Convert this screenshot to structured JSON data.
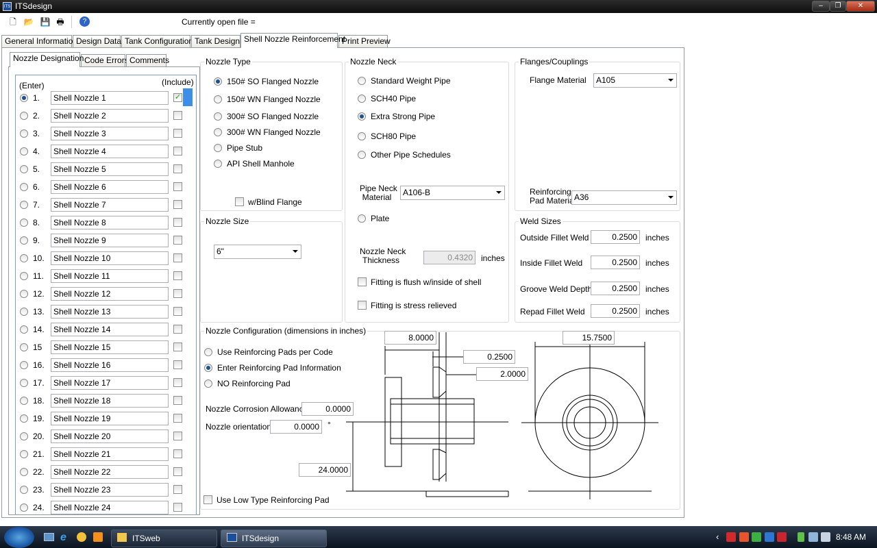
{
  "window": {
    "title": "ITSdesign",
    "app_icon_text": "ITS"
  },
  "toolbar": {
    "current_file_label": "Currently open file ="
  },
  "main_tabs": [
    "General Information",
    "Design Data",
    "Tank Configuration",
    "Tank Design",
    "Shell Nozzle Reinforcement",
    "Print Preview"
  ],
  "sub_tabs": [
    "Nozzle Designation",
    "Code Errors",
    "Comments"
  ],
  "nozzle_list": {
    "enter_label": "(Enter)",
    "include_label": "(Include)",
    "selected_index": 0,
    "items": [
      {
        "num": "1.",
        "name": "Shell Nozzle 1",
        "included": true
      },
      {
        "num": "2.",
        "name": "Shell Nozzle 2",
        "included": false
      },
      {
        "num": "3.",
        "name": "Shell Nozzle 3",
        "included": false
      },
      {
        "num": "4.",
        "name": "Shell Nozzle 4",
        "included": false
      },
      {
        "num": "5.",
        "name": "Shell Nozzle 5",
        "included": false
      },
      {
        "num": "6.",
        "name": "Shell Nozzle 6",
        "included": false
      },
      {
        "num": "7.",
        "name": "Shell Nozzle 7",
        "included": false
      },
      {
        "num": "8.",
        "name": "Shell Nozzle 8",
        "included": false
      },
      {
        "num": "9.",
        "name": "Shell Nozzle 9",
        "included": false
      },
      {
        "num": "10.",
        "name": "Shell Nozzle 10",
        "included": false
      },
      {
        "num": "11.",
        "name": "Shell Nozzle 11",
        "included": false
      },
      {
        "num": "12.",
        "name": "Shell Nozzle 12",
        "included": false
      },
      {
        "num": "13.",
        "name": "Shell Nozzle 13",
        "included": false
      },
      {
        "num": "14.",
        "name": "Shell Nozzle 14",
        "included": false
      },
      {
        "num": "15",
        "name": "Shell Nozzle 15",
        "included": false
      },
      {
        "num": "16.",
        "name": "Shell Nozzle 16",
        "included": false
      },
      {
        "num": "17.",
        "name": "Shell Nozzle 17",
        "included": false
      },
      {
        "num": "18.",
        "name": "Shell Nozzle 18",
        "included": false
      },
      {
        "num": "19.",
        "name": "Shell Nozzle 19",
        "included": false
      },
      {
        "num": "20.",
        "name": "Shell Nozzle 20",
        "included": false
      },
      {
        "num": "21.",
        "name": "Shell Nozzle 21",
        "included": false
      },
      {
        "num": "22.",
        "name": "Shell Nozzle 22",
        "included": false
      },
      {
        "num": "23.",
        "name": "Shell Nozzle 23",
        "included": false
      },
      {
        "num": "24.",
        "name": "Shell Nozzle 24",
        "included": false
      }
    ]
  },
  "nozzle_type": {
    "label": "Nozzle Type",
    "options": [
      "150# SO Flanged Nozzle",
      "150# WN Flanged Nozzle",
      "300# SO Flanged Nozzle",
      "300# WN Flanged Nozzle",
      "Pipe Stub",
      "API Shell Manhole"
    ],
    "selected": 0,
    "blind_flange_label": "w/Blind Flange"
  },
  "nozzle_size": {
    "label": "Nozzle Size",
    "value": "6\""
  },
  "nozzle_neck": {
    "label": "Nozzle Neck",
    "options": [
      "Standard Weight Pipe",
      "SCH40 Pipe",
      "Extra Strong Pipe",
      "SCH80 Pipe",
      "Other Pipe Schedules"
    ],
    "selected": 2,
    "pipe_neck_material_label1": "Pipe Neck",
    "pipe_neck_material_label2": "Material",
    "pipe_neck_material": "A106-B",
    "plate_label": "Plate",
    "thickness_label1": "Nozzle Neck",
    "thickness_label2": "Thickness",
    "thickness_value": "0.4320",
    "thickness_unit": "inches",
    "flush_label": "Fitting is flush w/inside of shell",
    "stress_label": "Fitting is stress relieved"
  },
  "flanges": {
    "label": "Flanges/Couplings",
    "flange_material_label": "Flange Material",
    "flange_material": "A105",
    "repad_label1": "Reinforcing",
    "repad_label2": "Pad Material",
    "repad_material": "A36"
  },
  "weld_sizes": {
    "label": "Weld Sizes",
    "rows": [
      {
        "label": "Outside Fillet Weld",
        "value": "0.2500",
        "unit": "inches"
      },
      {
        "label": "Inside Fillet Weld",
        "value": "0.2500",
        "unit": "inches"
      },
      {
        "label": "Groove Weld Depth",
        "value": "0.2500",
        "unit": "inches"
      },
      {
        "label": "Repad Fillet Weld",
        "value": "0.2500",
        "unit": "inches"
      }
    ]
  },
  "config": {
    "label": "Nozzle Configuration (dimensions in inches)",
    "options": [
      "Use Reinforcing Pads per Code",
      "Enter Reinforcing Pad Information",
      "NO Reinforcing Pad"
    ],
    "selected": 1,
    "corrosion_label": "Nozzle Corrosion Allowance",
    "corrosion_value": "0.0000",
    "orientation_label": "Nozzle orientation",
    "orientation_value": "0.0000",
    "orientation_unit": "°",
    "low_type_label": "Use Low Type Reinforcing Pad",
    "dim_projection": "8.0000",
    "dim_shell": "0.2500",
    "dim_pad_thk": "2.0000",
    "dim_height": "24.0000",
    "dim_pad_dia": "15.7500"
  },
  "taskbar": {
    "items": [
      "ITSweb",
      "ITSdesign"
    ],
    "clock": "8:48 AM"
  }
}
